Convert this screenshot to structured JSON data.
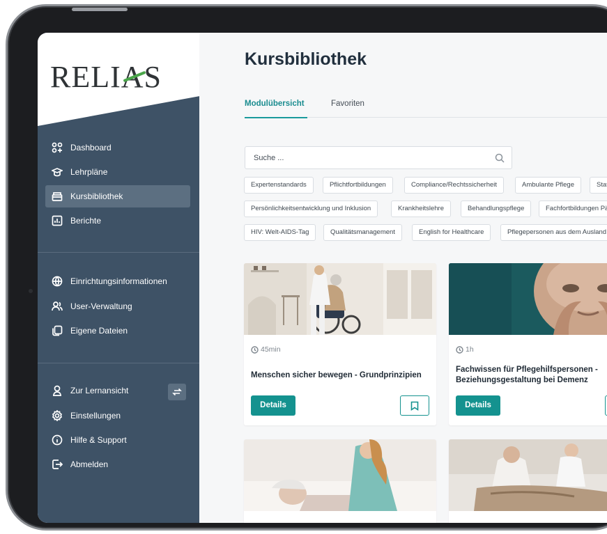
{
  "brand": {
    "logo_text": "RELIAS",
    "accent": "#14928f",
    "sidebar_bg": "#3e5266"
  },
  "sidebar": {
    "main_items": [
      {
        "label": "Dashboard",
        "icon": "dashboard-grid-icon",
        "active": false
      },
      {
        "label": "Lehrpläne",
        "icon": "graduation-cap-icon",
        "active": false
      },
      {
        "label": "Kursbibliothek",
        "icon": "library-box-icon",
        "active": true
      },
      {
        "label": "Berichte",
        "icon": "report-chart-icon",
        "active": false
      }
    ],
    "admin_items": [
      {
        "label": "Einrichtungsinformationen",
        "icon": "globe-icon"
      },
      {
        "label": "User-Verwaltung",
        "icon": "users-icon"
      },
      {
        "label": "Eigene Dateien",
        "icon": "files-icon"
      }
    ],
    "bottom_items": [
      {
        "label": "Zur Lernansicht",
        "icon": "person-icon"
      },
      {
        "label": "Einstellungen",
        "icon": "gear-icon"
      },
      {
        "label": "Hilfe & Support",
        "icon": "info-icon"
      },
      {
        "label": "Abmelden",
        "icon": "logout-icon"
      }
    ]
  },
  "main": {
    "title": "Kursbibliothek",
    "tabs": [
      {
        "label": "Modulübersicht",
        "active": true
      },
      {
        "label": "Favoriten",
        "active": false
      }
    ],
    "search": {
      "placeholder": "Suche ..."
    },
    "filters": {
      "row1": [
        "Expertenstandards",
        "Pflichtfortbildungen",
        "Compliance/Rechtssicherheit",
        "Ambulante Pflege",
        "Statio"
      ],
      "row2": [
        "Persönlichkeitsentwicklung und Inklusion",
        "Krankheitslehre",
        "Behandlungspflege",
        "Fachfortbildungen Pä"
      ],
      "row3": [
        "HIV: Welt-AIDS-Tag",
        "Qualitätsmanagement",
        "English for Healthcare",
        "Pflegepersonen aus dem Ausland"
      ]
    },
    "cards": [
      {
        "duration": "45min",
        "title": "Menschen sicher bewegen - Grundprinzipien",
        "button": "Details"
      },
      {
        "duration": "1h",
        "title": "Fachwissen für Pflegehilfspersonen - Beziehungsgestaltung bei Demenz",
        "button": "Details"
      }
    ]
  }
}
